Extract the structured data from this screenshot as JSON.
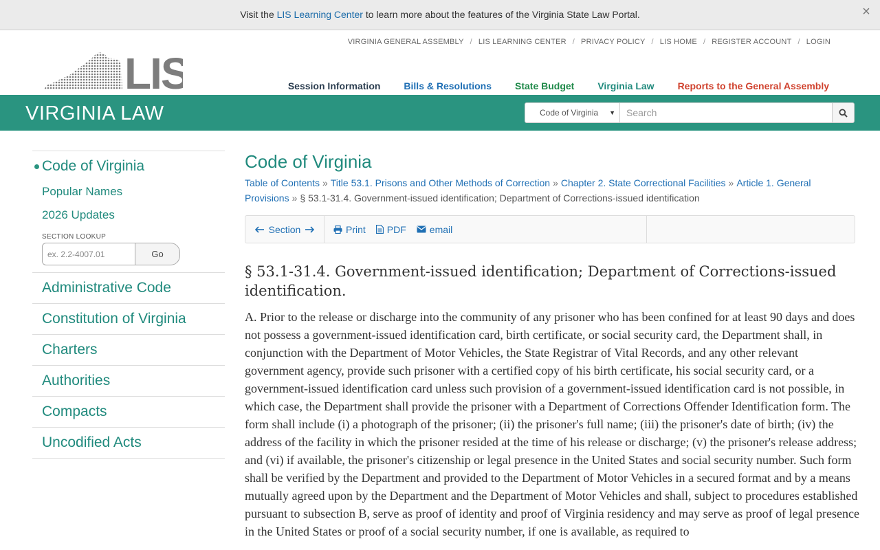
{
  "notice": {
    "prefix": "Visit the ",
    "link": "LIS Learning Center",
    "suffix": " to learn more about the features of the Virginia State Law Portal.",
    "close": "×"
  },
  "util_links": [
    "VIRGINIA GENERAL ASSEMBLY",
    "LIS LEARNING CENTER",
    "PRIVACY POLICY",
    "LIS HOME",
    "REGISTER ACCOUNT",
    "LOGIN"
  ],
  "util_sep": "/",
  "logo": {
    "text": "LIS"
  },
  "main_nav": [
    "Session Information",
    "Bills & Resolutions",
    "State Budget",
    "Virginia Law",
    "Reports to the General Assembly"
  ],
  "site_title": "VIRGINIA LAW",
  "search": {
    "select_value": "Code of Virginia",
    "placeholder": "Search",
    "icon": "search-icon"
  },
  "sidebar": {
    "code_title": "Code of Virginia",
    "sub_items": [
      "Popular Names",
      "2026 Updates"
    ],
    "lookup_label": "SECTION LOOKUP",
    "lookup_placeholder": "ex. 2.2-4007.01",
    "lookup_button": "Go",
    "items": [
      "Administrative Code",
      "Constitution of Virginia",
      "Charters",
      "Authorities",
      "Compacts",
      "Uncodified Acts"
    ]
  },
  "content": {
    "page_title": "Code of Virginia",
    "breadcrumbs": [
      "Table of Contents",
      "Title 53.1. Prisons and Other Methods of Correction",
      "Chapter 2. State Correctional Facilities",
      "Article 1. General Provisions"
    ],
    "breadcrumb_current": "§ 53.1-31.4. Government-issued identification; Department of Corrections-issued identification",
    "breadcrumb_sep": "»",
    "toolbar": {
      "section_label": "Section",
      "print_label": "Print",
      "pdf_label": "PDF",
      "email_label": "email"
    },
    "section_title": "§ 53.1-31.4. Government-issued identification; Department of Corrections-issued identification.",
    "section_body": "A. Prior to the release or discharge into the community of any prisoner who has been confined for at least 90 days and does not possess a government-issued identification card, birth certificate, or social security card, the Department shall, in conjunction with the Department of Motor Vehicles, the State Registrar of Vital Records, and any other relevant government agency, provide such prisoner with a certified copy of his birth certificate, his social security card, or a government-issued identification card unless such provision of a government-issued identification card is not possible, in which case, the Department shall provide the prisoner with a Department of Corrections Offender Identification form. The form shall include (i) a photograph of the prisoner; (ii) the prisoner's full name; (iii) the prisoner's date of birth; (iv) the address of the facility in which the prisoner resided at the time of his release or discharge; (v) the prisoner's release address; and (vi) if available, the prisoner's citizenship or legal presence in the United States and social security number. Such form shall be verified by the Department and provided to the Department of Motor Vehicles in a secured format and by a means mutually agreed upon by the Department and the Department of Motor Vehicles and shall, subject to procedures established pursuant to subsection B, serve as proof of identity and proof of Virginia residency and may serve as proof of legal presence in the United States or proof of a social security number, if one is available, as required to"
  },
  "colors": {
    "brand_green": "#2a9480",
    "link_teal": "#208a7d",
    "link_blue": "#1f6fb4",
    "nav_red": "#d0432f"
  }
}
